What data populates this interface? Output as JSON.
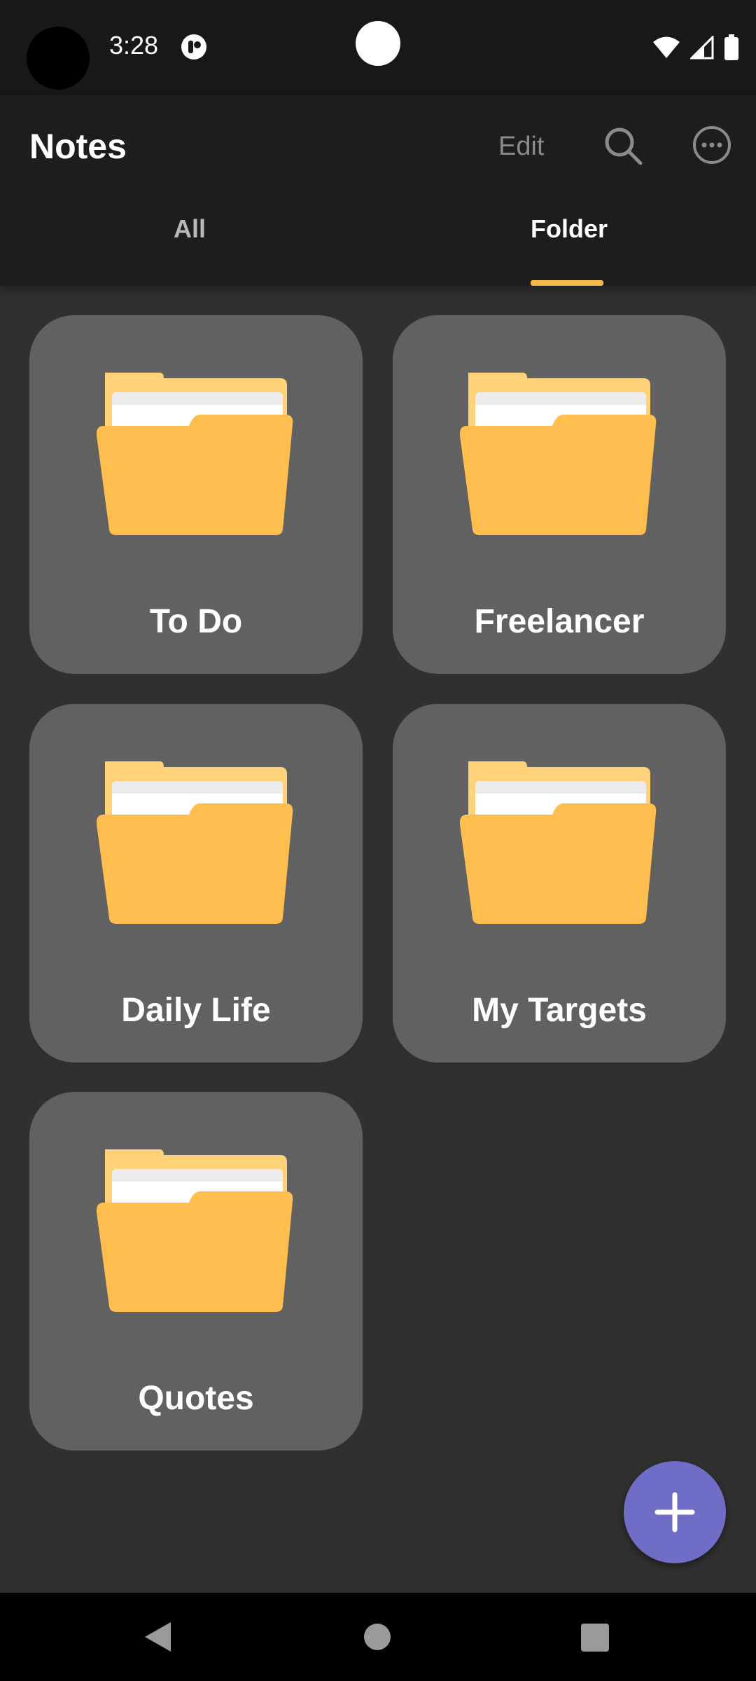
{
  "status_bar": {
    "time": "3:28",
    "icons": [
      "app-notification-icon",
      "wifi-icon",
      "cellular-signal-icon",
      "battery-icon"
    ]
  },
  "app_bar": {
    "title": "Notes",
    "edit_label": "Edit",
    "icons": [
      "search-icon",
      "more-options-icon"
    ]
  },
  "tabs": [
    {
      "label": "All",
      "selected": false
    },
    {
      "label": "Folder",
      "selected": true
    }
  ],
  "folders": [
    {
      "name": "To Do"
    },
    {
      "name": "Freelancer"
    },
    {
      "name": "Daily Life"
    },
    {
      "name": "My Targets"
    },
    {
      "name": "Quotes"
    }
  ],
  "fab": {
    "icon": "plus-icon"
  },
  "nav_bar": {
    "icons": [
      "back-icon",
      "home-icon",
      "recents-icon"
    ]
  },
  "colors": {
    "background": "#303030",
    "app_bar": "#1d1d1d",
    "card": "#616161",
    "accent": "#f7b84a",
    "folder": "#ffbe4d",
    "fab": "#6f6dc6"
  }
}
